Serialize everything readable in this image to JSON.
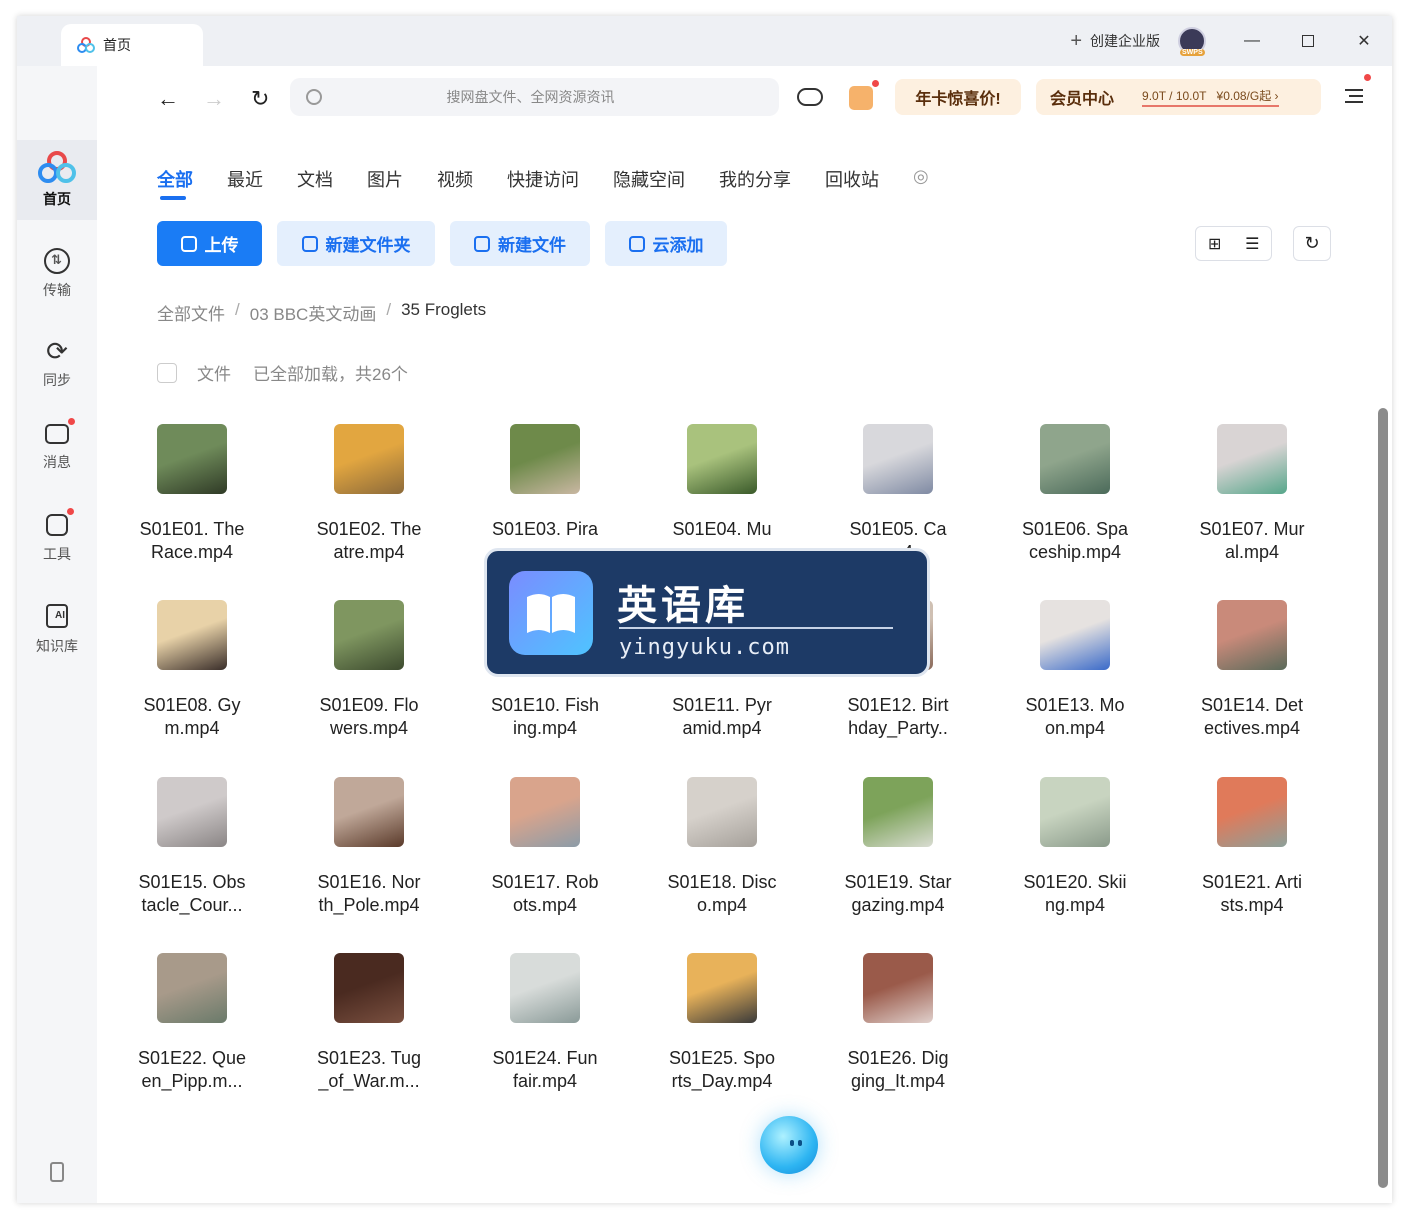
{
  "titlebar": {
    "tab_title": "首页",
    "create_enterprise": "创建企业版",
    "avatar_tag": "SWPS"
  },
  "sidebar": {
    "items": [
      {
        "label": "首页",
        "icon": "cloud-logo-icon"
      },
      {
        "label": "传输",
        "icon": "transfer-icon"
      },
      {
        "label": "同步",
        "icon": "sync-icon"
      },
      {
        "label": "消息",
        "icon": "message-icon"
      },
      {
        "label": "工具",
        "icon": "toolbox-icon"
      },
      {
        "label": "知识库",
        "icon": "ai-knowledge-icon"
      }
    ]
  },
  "toolbar": {
    "search_placeholder": "搜网盘文件、全网资源资讯",
    "annual_promo": "年卡惊喜价!",
    "member_center": "会员中心",
    "storage": "9.0T / 10.0T",
    "price": "¥0.08/G起"
  },
  "tabs": [
    "全部",
    "最近",
    "文档",
    "图片",
    "视频",
    "快捷访问",
    "隐藏空间",
    "我的分享",
    "回收站"
  ],
  "actions": {
    "upload": "上传",
    "new_folder": "新建文件夹",
    "new_file": "新建文件",
    "cloud_add": "云添加"
  },
  "breadcrumb": {
    "root": "全部文件",
    "parent": "03 BBC英文动画",
    "current": "35 Froglets"
  },
  "filebar": {
    "label": "文件",
    "status": "已全部加载，共26个"
  },
  "files": [
    {
      "l1": "S01E01. The",
      "l2": "Race.mp4"
    },
    {
      "l1": "S01E02. The",
      "l2": "atre.mp4"
    },
    {
      "l1": "S01E03. Pira",
      "l2": ""
    },
    {
      "l1": "S01E04. Mu",
      "l2": ""
    },
    {
      "l1": "S01E05. Ca",
      "l2": "np4"
    },
    {
      "l1": "S01E06. Spa",
      "l2": "ceship.mp4"
    },
    {
      "l1": "S01E07. Mur",
      "l2": "al.mp4"
    },
    {
      "l1": "S01E08. Gy",
      "l2": "m.mp4"
    },
    {
      "l1": "S01E09. Flo",
      "l2": "wers.mp4"
    },
    {
      "l1": "S01E10. Fish",
      "l2": "ing.mp4"
    },
    {
      "l1": "S01E11. Pyr",
      "l2": "amid.mp4"
    },
    {
      "l1": "S01E12. Birt",
      "l2": "hday_Party.."
    },
    {
      "l1": "S01E13. Mo",
      "l2": "on.mp4"
    },
    {
      "l1": "S01E14. Det",
      "l2": "ectives.mp4"
    },
    {
      "l1": "S01E15. Obs",
      "l2": "tacle_Cour..."
    },
    {
      "l1": "S01E16. Nor",
      "l2": "th_Pole.mp4"
    },
    {
      "l1": "S01E17. Rob",
      "l2": "ots.mp4"
    },
    {
      "l1": "S01E18. Disc",
      "l2": "o.mp4"
    },
    {
      "l1": "S01E19. Star",
      "l2": "gazing.mp4"
    },
    {
      "l1": "S01E20. Skii",
      "l2": "ng.mp4"
    },
    {
      "l1": "S01E21. Arti",
      "l2": "sts.mp4"
    },
    {
      "l1": "S01E22. Que",
      "l2": "en_Pipp.m..."
    },
    {
      "l1": "S01E23. Tug",
      "l2": "_of_War.m..."
    },
    {
      "l1": "S01E24. Fun",
      "l2": "fair.mp4"
    },
    {
      "l1": "S01E25. Spo",
      "l2": "rts_Day.mp4"
    },
    {
      "l1": "S01E26. Dig",
      "l2": "ging_It.mp4"
    }
  ],
  "watermark": {
    "title": "英语库",
    "domain": "yingyuku.com"
  },
  "colors": {
    "accent": "#1a7cf5",
    "promo_bg": "#fdf0e0",
    "badge_red": "#f04848"
  }
}
